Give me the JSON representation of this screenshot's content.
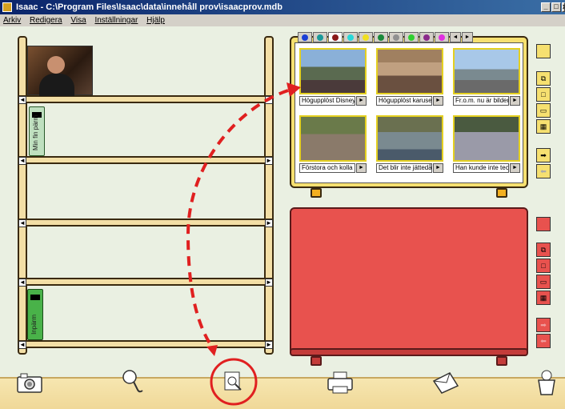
{
  "window": {
    "title": "Isaac - C:\\Program Files\\Isaac\\data\\innehåll prov\\isaacprov.mdb",
    "min_label": "_",
    "max_label": "□",
    "close_label": "x"
  },
  "menu": [
    "Arkiv",
    "Redigera",
    "Visa",
    "Inställningar",
    "Hjälp"
  ],
  "shelf": {
    "books": [
      {
        "label": "Min fin pärm",
        "color": "#bfe0bf"
      },
      {
        "label": "Inpärm",
        "color": "#49b249"
      }
    ]
  },
  "tabs": {
    "colors": [
      "#1a3fd6",
      "#1a9a9a",
      "#8a1a1a",
      "#28d8d8",
      "#f0e020",
      "#1a8a3a",
      "#909090",
      "#30d030",
      "#8a2a8a",
      "#e030e0"
    ],
    "nav_left": "◄",
    "nav_right": "►"
  },
  "thumbnails": [
    {
      "caption": "Högupplöst Disney",
      "tone": "#5a7aa0"
    },
    {
      "caption": "Högupplöst karusell",
      "tone": "#8a6a4a"
    },
    {
      "caption": "Fr.o.m. nu är bildern",
      "tone": "#7a9ab8"
    },
    {
      "caption": "Förstora och kolla",
      "tone": "#7a8a6a"
    },
    {
      "caption": "Det blir inte jättedåli",
      "tone": "#6a7a8a"
    },
    {
      "caption": "Han kunde inte tec",
      "tone": "#8a8aa0"
    }
  ],
  "play_glyph": "►",
  "side_buttons": {
    "yellow": [
      "color-swatch-yellow",
      "multi-page",
      "single",
      "two-cols",
      "three-cols",
      "forward",
      "back"
    ],
    "red": [
      "color-swatch-red",
      "multi-page",
      "single",
      "two-cols",
      "three-cols",
      "forward",
      "back"
    ]
  },
  "toolbar": [
    "camera",
    "magnifier",
    "search-picture",
    "printer",
    "envelope",
    "trash"
  ],
  "colors": {
    "yellow_panel": "#f6e070",
    "red_panel": "#e8524e",
    "highlight_red": "#e02020"
  }
}
